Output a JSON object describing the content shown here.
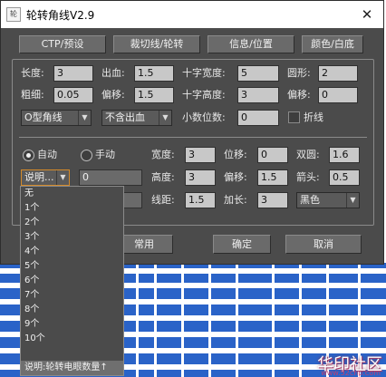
{
  "window": {
    "title": "轮转角线V2.9",
    "icon_text": "轮",
    "close_glyph": "✕"
  },
  "tabs": [
    "CTP/预设",
    "裁切线/轮转",
    "信息/位置",
    "颜色/白底"
  ],
  "settings": {
    "length": {
      "label": "长度:",
      "value": "3"
    },
    "bleed": {
      "label": "出血:",
      "value": "1.5"
    },
    "cross_width": {
      "label": "十字宽度:",
      "value": "5"
    },
    "circle": {
      "label": "圆形:",
      "value": "2"
    },
    "thickness": {
      "label": "粗细:",
      "value": "0.05"
    },
    "offset1": {
      "label": "偏移:",
      "value": "1.5"
    },
    "cross_height": {
      "label": "十字高度:",
      "value": "3"
    },
    "offset2": {
      "label": "偏移:",
      "value": "0"
    },
    "corner_type": {
      "value": "O型角线"
    },
    "bleed_mode": {
      "value": "不含出血"
    },
    "decimals": {
      "label": "小数位数:",
      "value": "0"
    },
    "fold_line": {
      "label": "折线",
      "checked": false
    }
  },
  "mode": {
    "auto_label": "自动",
    "manual_label": "手动",
    "selected": "auto",
    "note_select": "说明...",
    "note_value": "0",
    "width": {
      "label": "宽度:",
      "value": "3"
    },
    "shift": {
      "label": "位移:",
      "value": "0"
    },
    "double_circle": {
      "label": "双圆:",
      "value": "1.6"
    },
    "height": {
      "label": "高度:",
      "value": "3"
    },
    "offset": {
      "label": "偏移:",
      "value": "1.5"
    },
    "arrow": {
      "label": "箭头:",
      "value": "0.5"
    },
    "line_spacing": {
      "label": "线距:",
      "value": "1.5"
    },
    "extend": {
      "label": "加长:",
      "value": "3"
    },
    "color": {
      "value": "黑色"
    }
  },
  "buttons": {
    "common": "常用",
    "ok": "确定",
    "cancel": "取消"
  },
  "dropdown": {
    "items": [
      "无",
      "1个",
      "2个",
      "3个",
      "4个",
      "5个",
      "6个",
      "7个",
      "8个",
      "9个",
      "10个"
    ],
    "footer": "说明:轮转电眼数量↑"
  },
  "watermark": {
    "text": "华印社区",
    "url": "www.52cnp.com"
  },
  "colors": {
    "dialog_bg": "#4b4b4b",
    "field_bg": "#c8c8c8",
    "art_blue": "#2a63c8"
  }
}
